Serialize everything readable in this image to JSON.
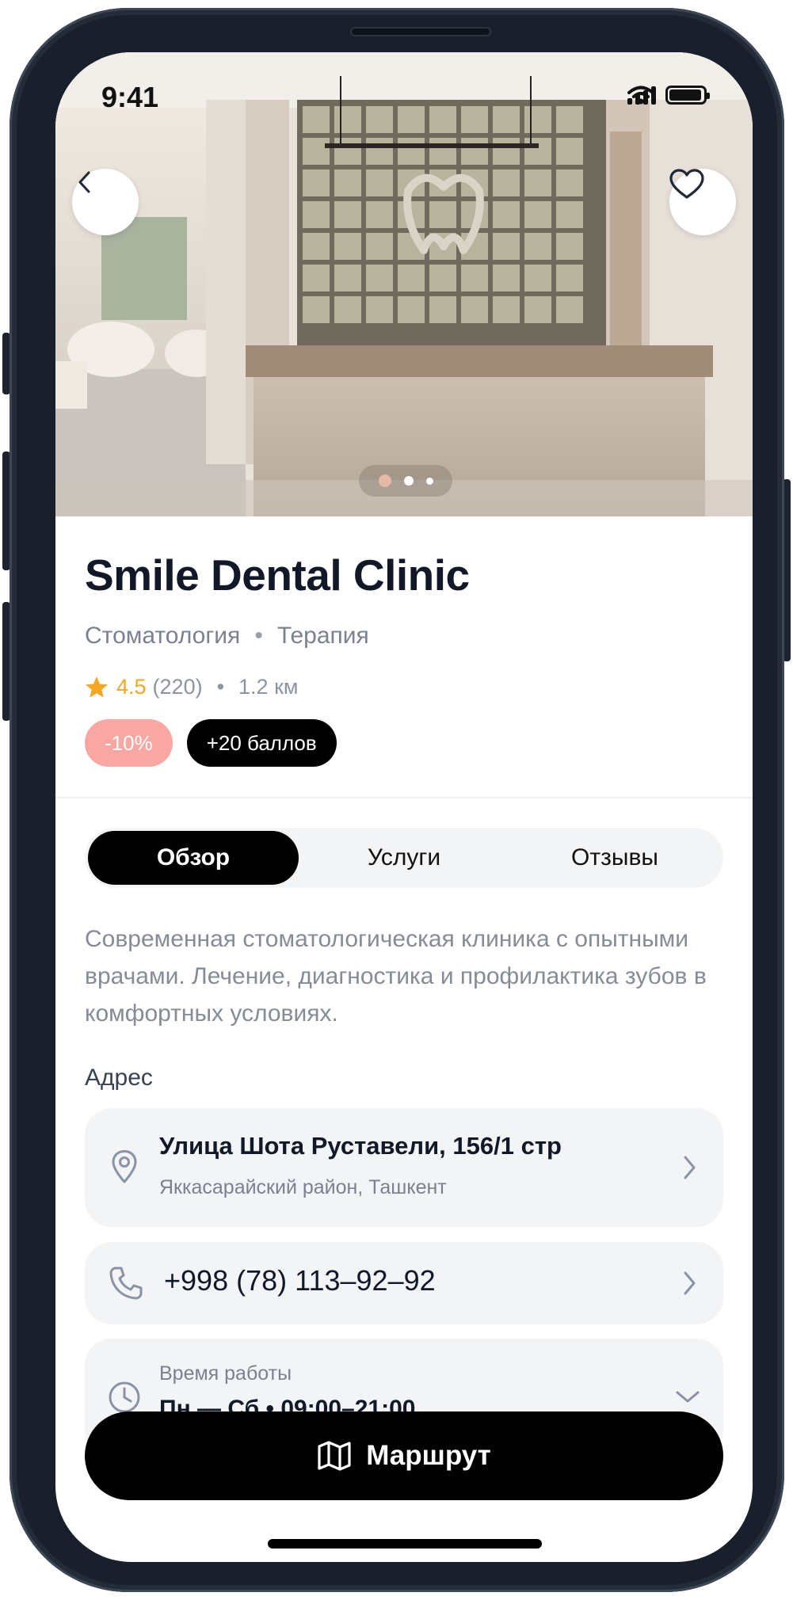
{
  "status_bar": {
    "time": "9:41"
  },
  "hero": {
    "images_total": 3,
    "active_image": 1,
    "dot_colors": {
      "active": "#e6b8a6",
      "inactive": "#ffffff"
    }
  },
  "clinic": {
    "name": "Smile Dental Clinic",
    "category": "Стоматология",
    "subcategory": "Терапия",
    "rating": "4.5",
    "reviews_count": "(220)",
    "distance": "1.2 км",
    "discount_badge": "-10%",
    "points_badge": "+20 баллов"
  },
  "tabs": [
    {
      "label": "Обзор",
      "active": true
    },
    {
      "label": "Услуги",
      "active": false
    },
    {
      "label": "Отзывы",
      "active": false
    }
  ],
  "overview": {
    "description": "Современная стоматологическая клиника с опытными врачами. Лечение, диагностика и профилактика зубов в комфортных условиях.",
    "address_label": "Адрес",
    "address_line": "Улица Шота Руставели, 156/1 стр",
    "address_district": "Яккасарайский район, Ташкент",
    "phone": "+998 (78) 113–92–92",
    "hours_label": "Время работы",
    "hours_value": "Пн — Сб • 09:00–21:00"
  },
  "cta": {
    "label": "Маршрут",
    "icon": "map-icon"
  },
  "colors": {
    "accent": "#000000",
    "rating_star": "#f5a622",
    "discount_chip": "#f9a7a2",
    "muted_text": "#7b8190"
  },
  "icons": {
    "back": "chevron-left-icon",
    "favorite": "heart-icon",
    "location": "location-pin-icon",
    "phone": "phone-icon",
    "clock": "clock-icon",
    "chevron": "chevron-right-icon",
    "expand": "chevron-down-icon"
  }
}
